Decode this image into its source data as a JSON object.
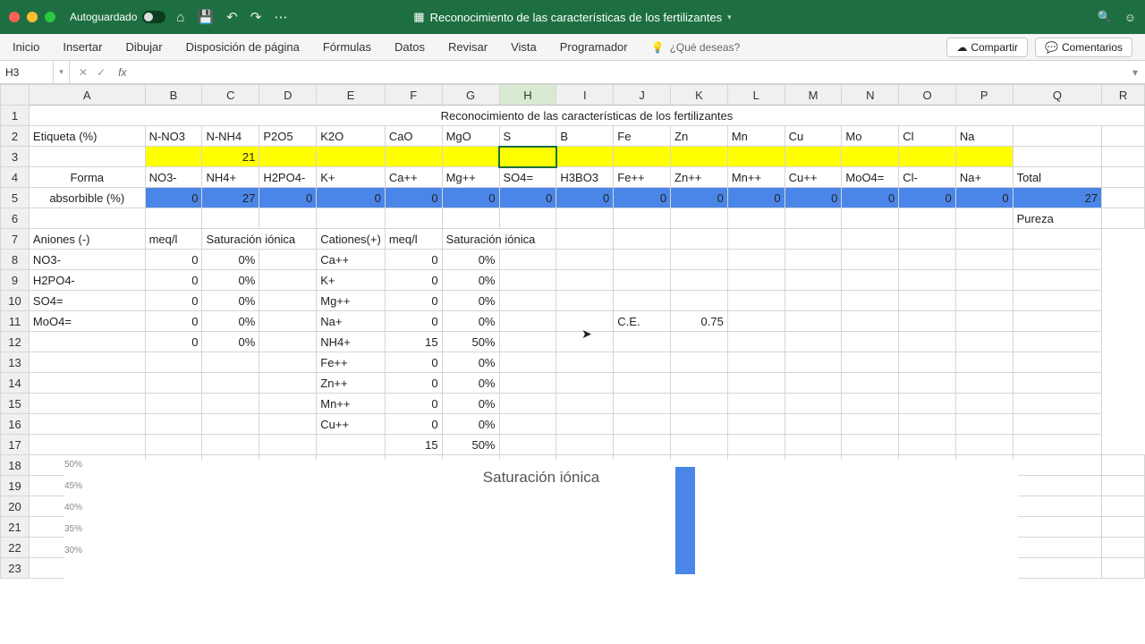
{
  "titlebar": {
    "autosave": "Autoguardado",
    "doc": "Reconocimiento de las características de los fertilizantes"
  },
  "ribbon": {
    "tabs": [
      "Inicio",
      "Insertar",
      "Dibujar",
      "Disposición de página",
      "Fórmulas",
      "Datos",
      "Revisar",
      "Vista",
      "Programador"
    ],
    "tellme": "¿Qué deseas?",
    "share": "Compartir",
    "comments": "Comentarios"
  },
  "fbar": {
    "name": "H3"
  },
  "cols": [
    "A",
    "B",
    "C",
    "D",
    "E",
    "F",
    "G",
    "H",
    "I",
    "J",
    "K",
    "L",
    "M",
    "N",
    "O",
    "P",
    "Q",
    "R"
  ],
  "row1_title": "Reconocimiento de las características de los fertilizantes",
  "row2": {
    "label": "Etiqueta (%)",
    "cells": [
      "N-NO3",
      "N-NH4",
      "P2O5",
      "K2O",
      "CaO",
      "MgO",
      "S",
      "B",
      "Fe",
      "Zn",
      "Mn",
      "Cu",
      "Mo",
      "Cl",
      "Na"
    ]
  },
  "row3_val": "21",
  "row4": {
    "labelA": "Forma",
    "cells": [
      "NO3-",
      "NH4+",
      "H2PO4-",
      "K+",
      "Ca++",
      "Mg++",
      "SO4=",
      "H3BO3",
      "Fe++",
      "Zn++",
      "Mn++",
      "Cu++",
      "MoO4=",
      "Cl-",
      "Na+"
    ],
    "total": "Total"
  },
  "row5": {
    "labelA": "absorbible (%)",
    "vals": [
      "0",
      "27",
      "0",
      "0",
      "0",
      "0",
      "0",
      "0",
      "0",
      "0",
      "0",
      "0",
      "0",
      "0",
      "0"
    ],
    "total": "27"
  },
  "row6_pureza": "Pureza",
  "row7": {
    "a": "Aniones (-)",
    "b": "meq/l",
    "c": "Saturación iónica",
    "e": "Cationes(+)",
    "f": "meq/l",
    "g": "Saturación iónica"
  },
  "anions": [
    {
      "n": "NO3-",
      "m": "0",
      "s": "0%"
    },
    {
      "n": "H2PO4-",
      "m": "0",
      "s": "0%"
    },
    {
      "n": "SO4=",
      "m": "0",
      "s": "0%"
    },
    {
      "n": "MoO4=",
      "m": "0",
      "s": "0%"
    },
    {
      "n": "",
      "m": "0",
      "s": "0%"
    }
  ],
  "cations": [
    {
      "n": "Ca++",
      "m": "0",
      "s": "0%"
    },
    {
      "n": "K+",
      "m": "0",
      "s": "0%"
    },
    {
      "n": "Mg++",
      "m": "0",
      "s": "0%"
    },
    {
      "n": "Na+",
      "m": "0",
      "s": "0%"
    },
    {
      "n": "NH4+",
      "m": "15",
      "s": "50%"
    },
    {
      "n": "Fe++",
      "m": "0",
      "s": "0%"
    },
    {
      "n": "Zn++",
      "m": "0",
      "s": "0%"
    },
    {
      "n": "Mn++",
      "m": "0",
      "s": "0%"
    },
    {
      "n": "Cu++",
      "m": "0",
      "s": "0%"
    },
    {
      "n": "",
      "m": "15",
      "s": "50%"
    }
  ],
  "ce": {
    "label": "C.E.",
    "val": "0.75"
  },
  "chart_data": {
    "type": "bar",
    "title": "Saturación iónica",
    "ylabels": [
      "50%",
      "45%",
      "40%",
      "35%",
      "30%"
    ],
    "bar_value": 50
  }
}
